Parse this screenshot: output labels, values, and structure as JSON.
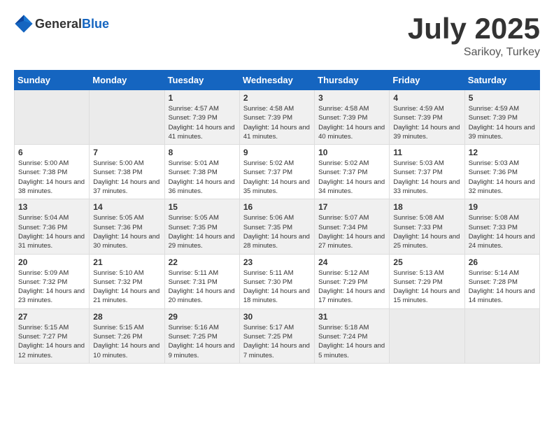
{
  "header": {
    "logo_general": "General",
    "logo_blue": "Blue",
    "month": "July 2025",
    "location": "Sarikoy, Turkey"
  },
  "days_of_week": [
    "Sunday",
    "Monday",
    "Tuesday",
    "Wednesday",
    "Thursday",
    "Friday",
    "Saturday"
  ],
  "weeks": [
    [
      {
        "day": "",
        "empty": true
      },
      {
        "day": "",
        "empty": true
      },
      {
        "day": "1",
        "sunrise": "Sunrise: 4:57 AM",
        "sunset": "Sunset: 7:39 PM",
        "daylight": "Daylight: 14 hours and 41 minutes."
      },
      {
        "day": "2",
        "sunrise": "Sunrise: 4:58 AM",
        "sunset": "Sunset: 7:39 PM",
        "daylight": "Daylight: 14 hours and 41 minutes."
      },
      {
        "day": "3",
        "sunrise": "Sunrise: 4:58 AM",
        "sunset": "Sunset: 7:39 PM",
        "daylight": "Daylight: 14 hours and 40 minutes."
      },
      {
        "day": "4",
        "sunrise": "Sunrise: 4:59 AM",
        "sunset": "Sunset: 7:39 PM",
        "daylight": "Daylight: 14 hours and 39 minutes."
      },
      {
        "day": "5",
        "sunrise": "Sunrise: 4:59 AM",
        "sunset": "Sunset: 7:39 PM",
        "daylight": "Daylight: 14 hours and 39 minutes."
      }
    ],
    [
      {
        "day": "6",
        "sunrise": "Sunrise: 5:00 AM",
        "sunset": "Sunset: 7:38 PM",
        "daylight": "Daylight: 14 hours and 38 minutes."
      },
      {
        "day": "7",
        "sunrise": "Sunrise: 5:00 AM",
        "sunset": "Sunset: 7:38 PM",
        "daylight": "Daylight: 14 hours and 37 minutes."
      },
      {
        "day": "8",
        "sunrise": "Sunrise: 5:01 AM",
        "sunset": "Sunset: 7:38 PM",
        "daylight": "Daylight: 14 hours and 36 minutes."
      },
      {
        "day": "9",
        "sunrise": "Sunrise: 5:02 AM",
        "sunset": "Sunset: 7:37 PM",
        "daylight": "Daylight: 14 hours and 35 minutes."
      },
      {
        "day": "10",
        "sunrise": "Sunrise: 5:02 AM",
        "sunset": "Sunset: 7:37 PM",
        "daylight": "Daylight: 14 hours and 34 minutes."
      },
      {
        "day": "11",
        "sunrise": "Sunrise: 5:03 AM",
        "sunset": "Sunset: 7:37 PM",
        "daylight": "Daylight: 14 hours and 33 minutes."
      },
      {
        "day": "12",
        "sunrise": "Sunrise: 5:03 AM",
        "sunset": "Sunset: 7:36 PM",
        "daylight": "Daylight: 14 hours and 32 minutes."
      }
    ],
    [
      {
        "day": "13",
        "sunrise": "Sunrise: 5:04 AM",
        "sunset": "Sunset: 7:36 PM",
        "daylight": "Daylight: 14 hours and 31 minutes."
      },
      {
        "day": "14",
        "sunrise": "Sunrise: 5:05 AM",
        "sunset": "Sunset: 7:36 PM",
        "daylight": "Daylight: 14 hours and 30 minutes."
      },
      {
        "day": "15",
        "sunrise": "Sunrise: 5:05 AM",
        "sunset": "Sunset: 7:35 PM",
        "daylight": "Daylight: 14 hours and 29 minutes."
      },
      {
        "day": "16",
        "sunrise": "Sunrise: 5:06 AM",
        "sunset": "Sunset: 7:35 PM",
        "daylight": "Daylight: 14 hours and 28 minutes."
      },
      {
        "day": "17",
        "sunrise": "Sunrise: 5:07 AM",
        "sunset": "Sunset: 7:34 PM",
        "daylight": "Daylight: 14 hours and 27 minutes."
      },
      {
        "day": "18",
        "sunrise": "Sunrise: 5:08 AM",
        "sunset": "Sunset: 7:33 PM",
        "daylight": "Daylight: 14 hours and 25 minutes."
      },
      {
        "day": "19",
        "sunrise": "Sunrise: 5:08 AM",
        "sunset": "Sunset: 7:33 PM",
        "daylight": "Daylight: 14 hours and 24 minutes."
      }
    ],
    [
      {
        "day": "20",
        "sunrise": "Sunrise: 5:09 AM",
        "sunset": "Sunset: 7:32 PM",
        "daylight": "Daylight: 14 hours and 23 minutes."
      },
      {
        "day": "21",
        "sunrise": "Sunrise: 5:10 AM",
        "sunset": "Sunset: 7:32 PM",
        "daylight": "Daylight: 14 hours and 21 minutes."
      },
      {
        "day": "22",
        "sunrise": "Sunrise: 5:11 AM",
        "sunset": "Sunset: 7:31 PM",
        "daylight": "Daylight: 14 hours and 20 minutes."
      },
      {
        "day": "23",
        "sunrise": "Sunrise: 5:11 AM",
        "sunset": "Sunset: 7:30 PM",
        "daylight": "Daylight: 14 hours and 18 minutes."
      },
      {
        "day": "24",
        "sunrise": "Sunrise: 5:12 AM",
        "sunset": "Sunset: 7:29 PM",
        "daylight": "Daylight: 14 hours and 17 minutes."
      },
      {
        "day": "25",
        "sunrise": "Sunrise: 5:13 AM",
        "sunset": "Sunset: 7:29 PM",
        "daylight": "Daylight: 14 hours and 15 minutes."
      },
      {
        "day": "26",
        "sunrise": "Sunrise: 5:14 AM",
        "sunset": "Sunset: 7:28 PM",
        "daylight": "Daylight: 14 hours and 14 minutes."
      }
    ],
    [
      {
        "day": "27",
        "sunrise": "Sunrise: 5:15 AM",
        "sunset": "Sunset: 7:27 PM",
        "daylight": "Daylight: 14 hours and 12 minutes."
      },
      {
        "day": "28",
        "sunrise": "Sunrise: 5:15 AM",
        "sunset": "Sunset: 7:26 PM",
        "daylight": "Daylight: 14 hours and 10 minutes."
      },
      {
        "day": "29",
        "sunrise": "Sunrise: 5:16 AM",
        "sunset": "Sunset: 7:25 PM",
        "daylight": "Daylight: 14 hours and 9 minutes."
      },
      {
        "day": "30",
        "sunrise": "Sunrise: 5:17 AM",
        "sunset": "Sunset: 7:25 PM",
        "daylight": "Daylight: 14 hours and 7 minutes."
      },
      {
        "day": "31",
        "sunrise": "Sunrise: 5:18 AM",
        "sunset": "Sunset: 7:24 PM",
        "daylight": "Daylight: 14 hours and 5 minutes."
      },
      {
        "day": "",
        "empty": true
      },
      {
        "day": "",
        "empty": true
      }
    ]
  ]
}
